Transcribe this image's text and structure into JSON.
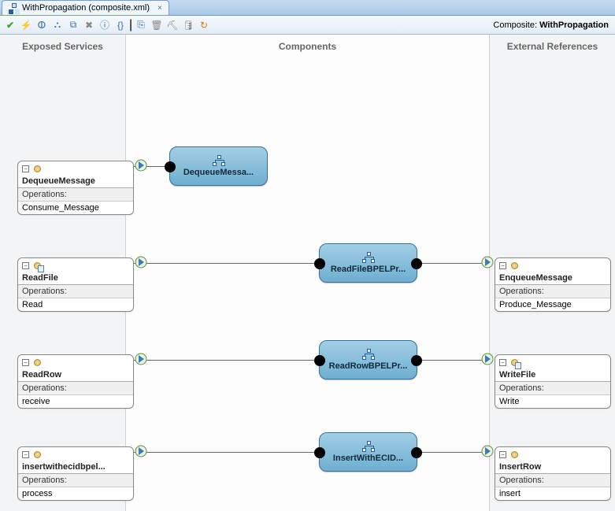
{
  "tab": {
    "title": "WithPropagation (composite.xml)"
  },
  "toolbar": {
    "composite_label": "Composite:",
    "composite_name": "WithPropagation"
  },
  "columns": {
    "left": "Exposed Services",
    "middle": "Components",
    "right": "External References"
  },
  "ops_label": "Operations:",
  "exposed": [
    {
      "name": "DequeueMessage",
      "op": "Consume_Message"
    },
    {
      "name": "ReadFile",
      "op": "Read"
    },
    {
      "name": "ReadRow",
      "op": "receive"
    },
    {
      "name": "insertwithecidbpel...",
      "op": "process"
    }
  ],
  "components": [
    {
      "name": "DequeueMessa..."
    },
    {
      "name": "ReadFileBPELPr..."
    },
    {
      "name": "ReadRowBPELPr..."
    },
    {
      "name": "InsertWithECID..."
    }
  ],
  "references": [
    {
      "name": "EnqueueMessage",
      "op": "Produce_Message"
    },
    {
      "name": "WriteFile",
      "op": "Write"
    },
    {
      "name": "InsertRow",
      "op": "insert"
    }
  ]
}
